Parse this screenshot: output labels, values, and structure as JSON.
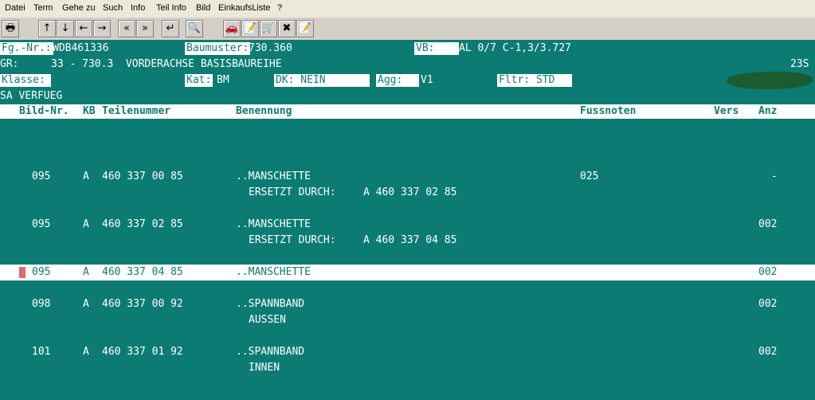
{
  "menu": [
    "Datei",
    "Term",
    "Gehe zu",
    "Such",
    "Info",
    "Teil Info",
    "Bild",
    "EinkaufsListe",
    "?"
  ],
  "toolbar": {
    "icons": [
      "printer-icon",
      "arrow-up-icon",
      "arrow-down-icon",
      "arrow-left-icon",
      "arrow-right-icon",
      "page-back-icon",
      "page-forward-icon",
      "enter-icon",
      "search-icon",
      "car-icon",
      "car-note-icon",
      "cart-icon",
      "cart-remove-icon",
      "cart-note-icon"
    ],
    "glyphs": [
      "🖶",
      "↑",
      "↓",
      "←",
      "→",
      "«",
      "»",
      "↵",
      "🔍",
      "🚗",
      "📝",
      "🛒",
      "✖",
      "📝"
    ]
  },
  "header": {
    "fg_label": "Fg.-Nr.:",
    "fg_value": "WDB461336",
    "baumuster_label": "Baumuster:",
    "baumuster_value": "730.360",
    "vb_label": "VB:",
    "vb_value": "AL 0/7 C-1,3/3.727",
    "gr_label": "GR:",
    "gr_value": "33 - 730.3  VORDERACHSE BASISBAUREIHE",
    "code_right": "23S",
    "klasse_label": "Klasse:",
    "kat_label": "Kat:",
    "kat_value": "BM",
    "dk_value": "DK: NEIN",
    "agg_label": "Agg:",
    "agg_value": "V1",
    "fltr_value": "Fltr: STD",
    "sa_line": "SA VERFUEG"
  },
  "columns": {
    "bild": "Bild-Nr.",
    "kb": "KB",
    "teil": "Teilenummer",
    "benennung": "Benennung",
    "fussnoten": "Fussnoten",
    "vers": "Vers",
    "anz": "Anz"
  },
  "rows": [
    {
      "bild": "095",
      "kb": "A",
      "teil": "460 337 00 85",
      "benennung": "..MANSCHETTE",
      "fussnoten": "025",
      "anz": "-",
      "sub1": "ERSETZT DURCH:",
      "sub2": "A 460 337 02 85"
    },
    {
      "bild": "095",
      "kb": "A",
      "teil": "460 337 02 85",
      "benennung": "..MANSCHETTE",
      "fussnoten": "",
      "anz": "002",
      "sub1": "ERSETZT DURCH:",
      "sub2": "A 460 337 04 85"
    },
    {
      "bild": "095",
      "kb": "A",
      "teil": "460 337 04 85",
      "benennung": "..MANSCHETTE",
      "fussnoten": "",
      "anz": "002",
      "sub1": "",
      "sub2": ""
    },
    {
      "bild": "098",
      "kb": "A",
      "teil": "460 337 00 92",
      "benennung": "..SPANNBAND",
      "fussnoten": "",
      "anz": "002",
      "sub1": "AUSSEN",
      "sub2": ""
    },
    {
      "bild": "101",
      "kb": "A",
      "teil": "460 337 01 92",
      "benennung": "..SPANNBAND",
      "fussnoten": "",
      "anz": "002",
      "sub1": "INNEN",
      "sub2": ""
    }
  ]
}
